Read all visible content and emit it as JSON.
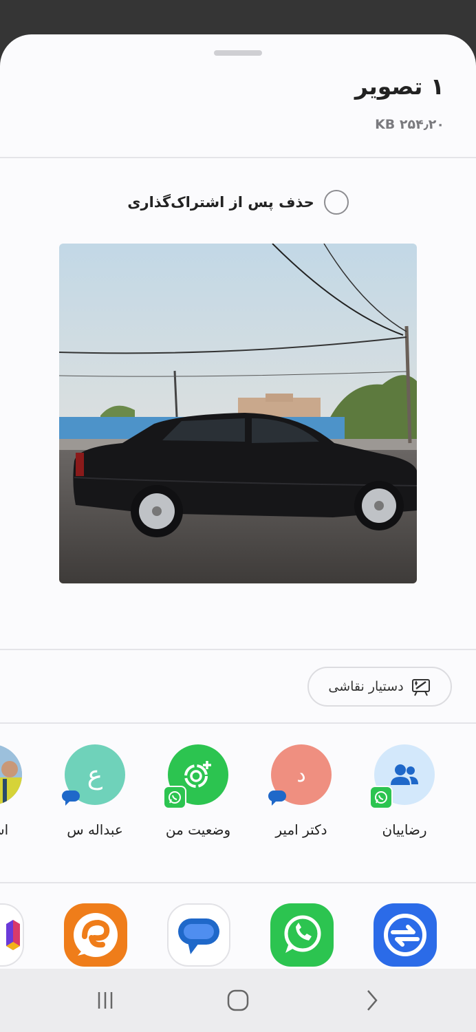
{
  "sheet": {
    "title": "۱ تصویر",
    "size": "۲۵۴٫۲۰ KB"
  },
  "delete_option": {
    "label": "حذف پس از اشتراک‌گذاری",
    "checked": false
  },
  "drawing_assistant": {
    "label": "دستیار نقاشی"
  },
  "contacts": [
    {
      "name": "رضاییان",
      "avatar_icon": "people-icon",
      "avatar_color": "#d3e8fb",
      "badge": "whatsapp"
    },
    {
      "name": "دکتر امیر",
      "avatar_letter": "د",
      "avatar_color": "#ef8f80",
      "badge": "messages"
    },
    {
      "name": "وضعیت من",
      "avatar_icon": "status-camera-icon",
      "avatar_color": "#2cc450",
      "badge": "whatsapp"
    },
    {
      "name": "عبداله س",
      "avatar_letter": "ع",
      "avatar_color": "#6fd2ba",
      "badge": "messages"
    },
    {
      "name": "اسدی",
      "avatar_icon": "photo-avatar",
      "avatar_color": "#8fb8d8",
      "badge": ""
    }
  ],
  "apps": [
    {
      "name": "quick-share-app",
      "icon": "quick-share-icon",
      "color": "#2b6be8"
    },
    {
      "name": "whatsapp-app",
      "icon": "whatsapp-icon",
      "color": "#2cc450"
    },
    {
      "name": "messages-app",
      "icon": "messages-icon",
      "color": "#ffffff"
    },
    {
      "name": "eitaa-app",
      "icon": "eitaa-icon",
      "color": "#ef7d1a"
    },
    {
      "name": "other-app",
      "icon": "cube-icon",
      "color": "#ffffff"
    }
  ],
  "navbar": {
    "recents": "recents-icon",
    "home": "home-icon",
    "back": "back-icon"
  }
}
